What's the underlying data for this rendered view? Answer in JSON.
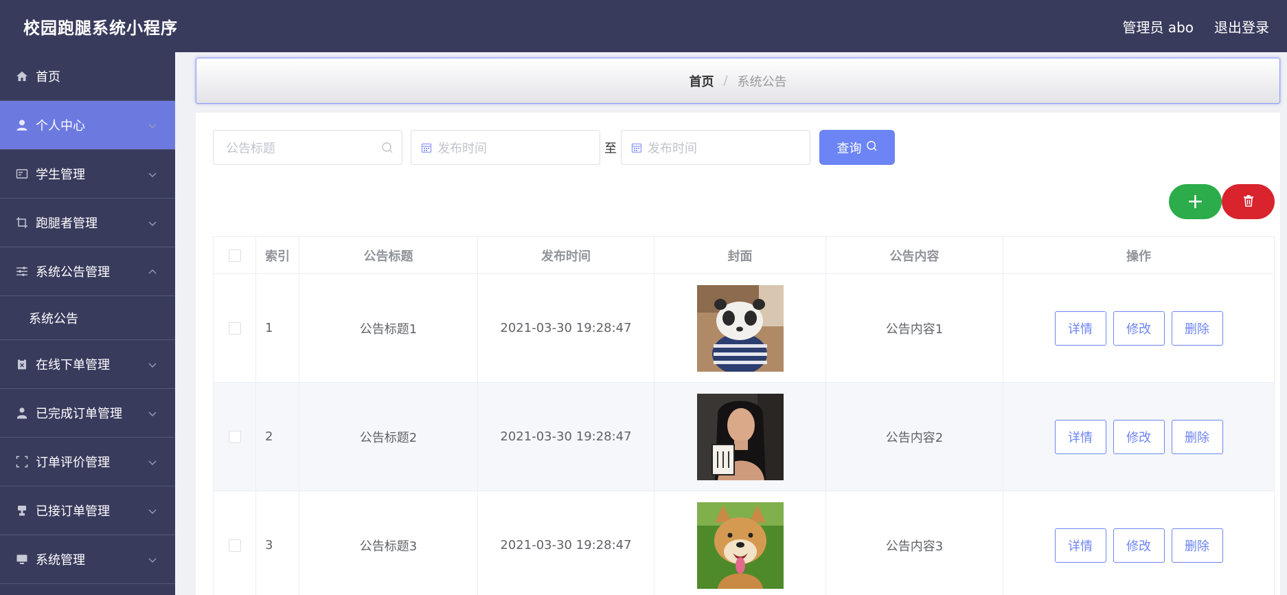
{
  "header": {
    "app_title": "校园跑腿系统小程序",
    "user_label": "管理员 abo",
    "logout_label": "退出登录"
  },
  "sidebar": {
    "items": [
      {
        "label": "首页",
        "icon": "home-icon"
      },
      {
        "label": "个人中心",
        "icon": "user-icon"
      },
      {
        "label": "学生管理",
        "icon": "id-card-icon"
      },
      {
        "label": "跑腿者管理",
        "icon": "crop-icon"
      },
      {
        "label": "系统公告管理",
        "icon": "sliders-icon"
      },
      {
        "label": "在线下单管理",
        "icon": "clipboard-icon"
      },
      {
        "label": "已完成订单管理",
        "icon": "user-check-icon"
      },
      {
        "label": "订单评价管理",
        "icon": "frame-icon"
      },
      {
        "label": "已接订单管理",
        "icon": "stamp-icon"
      },
      {
        "label": "系统管理",
        "icon": "monitor-icon"
      }
    ],
    "sub_item": "系统公告"
  },
  "breadcrumb": {
    "home": "首页",
    "separator": "/",
    "current": "系统公告"
  },
  "search": {
    "title_placeholder": "公告标题",
    "date_from_placeholder": "发布时间",
    "to_label": "至",
    "date_to_placeholder": "发布时间",
    "query_label": "查询"
  },
  "actions": {
    "add_label": "+"
  },
  "table": {
    "columns": [
      "索引",
      "公告标题",
      "发布时间",
      "封面",
      "公告内容",
      "操作"
    ],
    "rows": [
      {
        "index": "1",
        "title": "公告标题1",
        "time": "2021-03-30 19:28:47",
        "content": "公告内容1",
        "cover": "panda-dog-photo"
      },
      {
        "index": "2",
        "title": "公告标题2",
        "time": "2021-03-30 19:28:47",
        "content": "公告内容2",
        "cover": "woman-with-sign-photo"
      },
      {
        "index": "3",
        "title": "公告标题3",
        "time": "2021-03-30 19:28:47",
        "content": "公告内容3",
        "cover": "shiba-dog-photo"
      }
    ],
    "ops": {
      "detail": "详情",
      "edit": "修改",
      "delete": "删除"
    }
  },
  "colors": {
    "header_bg": "#393b5d",
    "active_nav": "#6c7ae0",
    "primary": "#6c84f4",
    "success": "#2cac4a",
    "danger": "#d9232d"
  }
}
